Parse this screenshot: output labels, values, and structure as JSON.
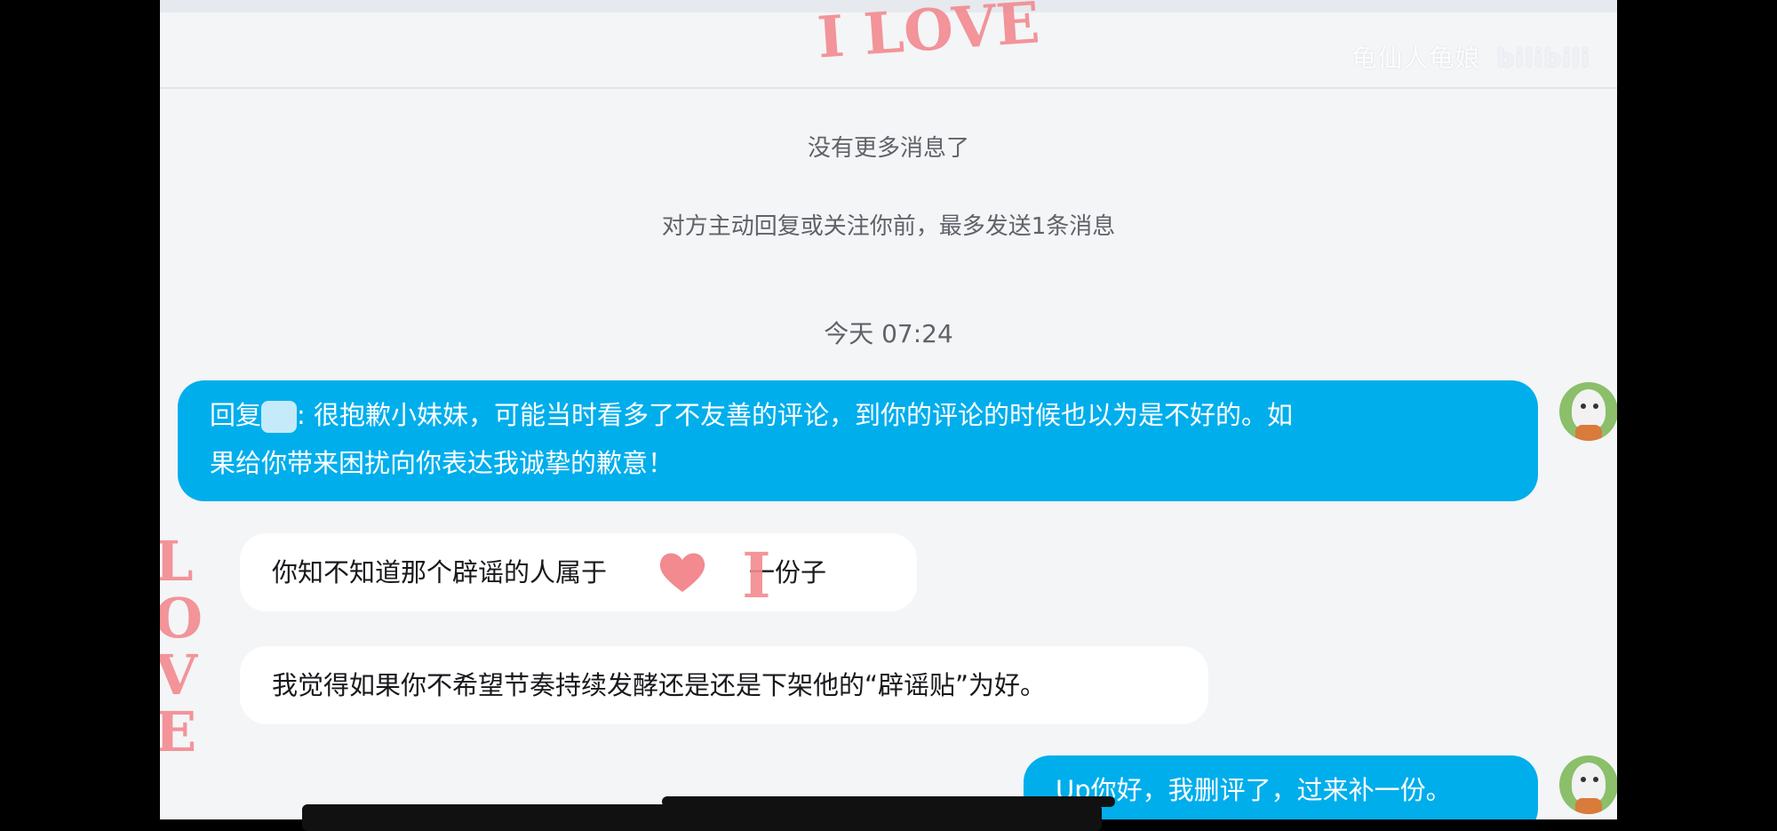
{
  "watermark": {
    "text": "龟仙人龟娘",
    "logo": "bilibili"
  },
  "messages_notice": "没有更多消息了",
  "limit_notice": "对方主动回复或关注你前，最多发送1条消息",
  "timestamp": "今天 07:24",
  "messages": [
    {
      "side": "mine",
      "prefix": "回复",
      "text_line1": ": 很抱歉小妹妹，可能当时看多了不友善的评论，到你的评论的时候也以为是不好的。如",
      "text_line2": "果给你带来困扰向你表达我诚挚的歉意！"
    },
    {
      "side": "theirs",
      "text_before": "你知不知道那个辟谣的人属于",
      "text_after": "一份子"
    },
    {
      "side": "theirs",
      "text": "我觉得如果你不希望节奏持续发酵还是还是下架他的“辟谣贴”为好。"
    },
    {
      "side": "mine",
      "text": "Up你好，我删评了，过来补一份。"
    }
  ],
  "stickers": [
    "I LOVE",
    "LOVE",
    "I"
  ],
  "colors": {
    "mine_bubble": "#00aeec",
    "theirs_bubble": "#ffffff",
    "background": "#f4f5f7",
    "sticker": "#f28a8f"
  }
}
